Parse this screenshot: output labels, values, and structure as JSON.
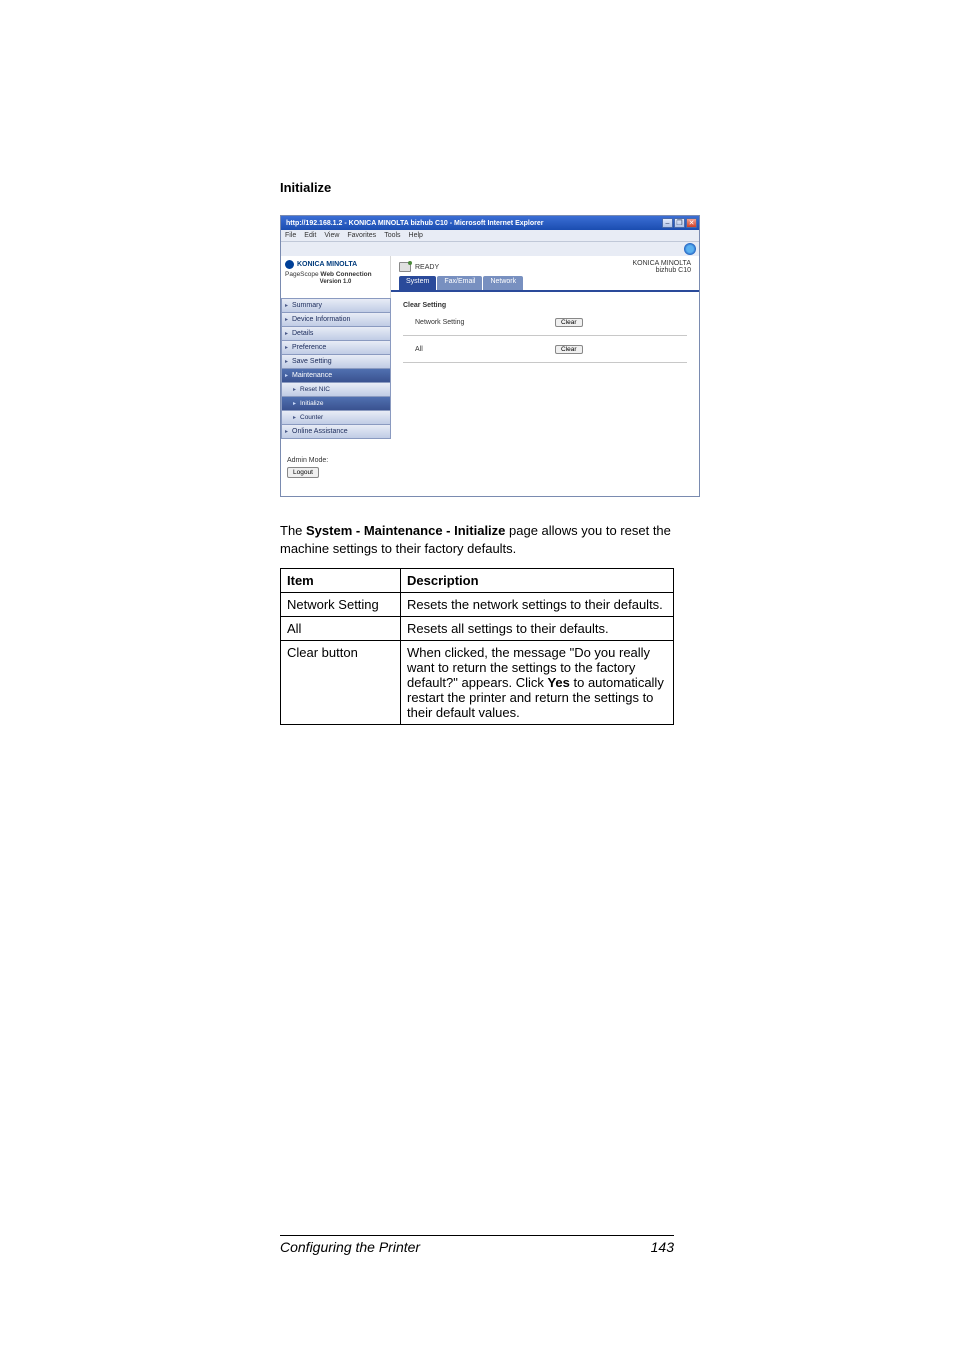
{
  "page": {
    "heading": "Initialize",
    "description_prefix": "The ",
    "description_bold": "System - Maintenance - Initialize",
    "description_suffix": " page allows you to reset the machine settings to their factory defaults."
  },
  "browser": {
    "title": "http://192.168.1.2 - KONICA MINOLTA bizhub C10 - Microsoft Internet Explorer",
    "menu": {
      "file": "File",
      "edit": "Edit",
      "view": "View",
      "favorites": "Favorites",
      "tools": "Tools",
      "help": "Help"
    }
  },
  "brand": {
    "name": "KONICA MINOLTA",
    "pagescope_prefix": "PageScope ",
    "pagescope_bold": "Web Connection",
    "version": "Version 1.0"
  },
  "status": {
    "ready": "READY",
    "device_line1": "KONICA MINOLTA",
    "device_line2": "bizhub C10"
  },
  "tabs": {
    "system": "System",
    "fax_email": "Fax/Email",
    "network": "Network"
  },
  "nav": {
    "summary": "Summary",
    "device_info": "Device Information",
    "details": "Details",
    "preference": "Preference",
    "save_setting": "Save Setting",
    "maintenance": "Maintenance",
    "reset_nic": "Reset NIC",
    "initialize": "Initialize",
    "counter": "Counter",
    "online_assistance": "Online Assistance"
  },
  "admin": {
    "label": "Admin Mode:",
    "logout": "Logout"
  },
  "panel": {
    "heading": "Clear Setting",
    "network_setting": "Network Setting",
    "all": "All",
    "clear": "Clear"
  },
  "table": {
    "header_item": "Item",
    "header_desc": "Description",
    "rows": [
      {
        "item": "Network Setting",
        "desc": "Resets the network settings to their defaults."
      },
      {
        "item": "All",
        "desc": "Resets all settings to their defaults."
      },
      {
        "item": "Clear button",
        "desc": "When clicked, the message \"Do you really want to return the settings to the factory default?\" appears. Click Yes to automatically restart the printer and return the settings to their default values.",
        "bold_word": "Yes"
      }
    ]
  },
  "footer": {
    "left": "Configuring the Printer",
    "right": "143"
  }
}
